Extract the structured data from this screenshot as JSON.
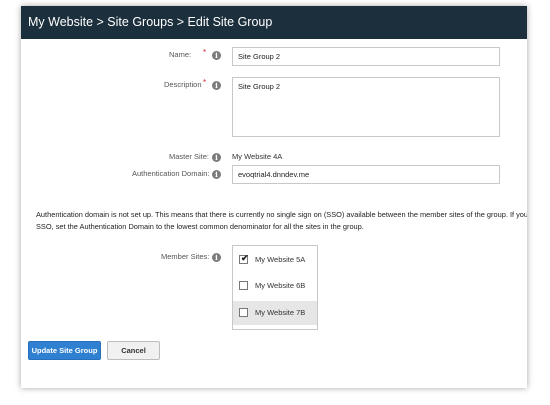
{
  "header": {
    "title": "My Website > Site Groups > Edit Site Group"
  },
  "form": {
    "name": {
      "label": "Name:",
      "required_mark": "*",
      "value": "Site Group 2"
    },
    "description": {
      "label": "Description",
      "required_mark": "*",
      "value": "Site Group 2"
    },
    "master_site": {
      "label": "Master Site:",
      "value": "My Website 4A"
    },
    "auth_domain": {
      "label": "Authentication Domain:",
      "value": "evoqtrial4.dnndev.me"
    },
    "note_line1": "Authentication domain is not set up. This means that there is currently no single sign on (SSO) available between the member sites of the group. If you w",
    "note_line2": "SSO, set the Authentication Domain to the lowest common denominator for all the sites in the group.",
    "member_sites": {
      "label": "Member Sites:",
      "items": [
        {
          "label": "My Website 5A",
          "checked": true
        },
        {
          "label": "My Website 6B",
          "checked": false
        },
        {
          "label": "My Website 7B",
          "checked": false
        }
      ]
    }
  },
  "buttons": {
    "update": "Update Site Group",
    "cancel": "Cancel"
  },
  "icons": {
    "info": "info-icon",
    "check": "checkmark-icon"
  },
  "colors": {
    "header_bg": "#1c2f3d",
    "primary": "#2f80d1",
    "required": "#d9262c"
  }
}
